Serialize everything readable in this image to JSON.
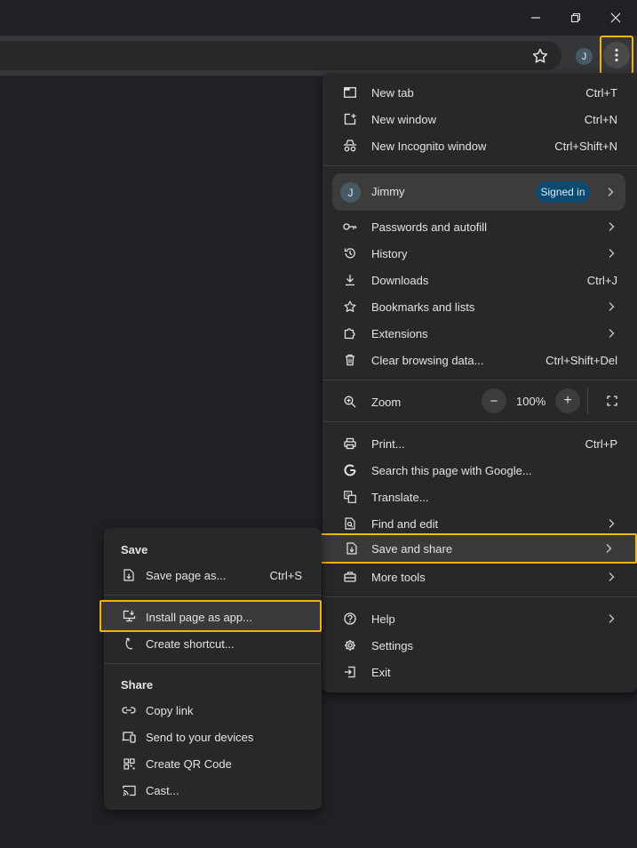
{
  "window": {
    "controls": [
      "minimize",
      "restore",
      "close"
    ]
  },
  "toolbar": {
    "avatar_initial": "J"
  },
  "menu": {
    "section1": [
      {
        "label": "New tab",
        "shortcut": "Ctrl+T",
        "icon": "new-tab-icon"
      },
      {
        "label": "New window",
        "shortcut": "Ctrl+N",
        "icon": "new-window-icon"
      },
      {
        "label": "New Incognito window",
        "shortcut": "Ctrl+Shift+N",
        "icon": "incognito-icon"
      }
    ],
    "profile": {
      "initial": "J",
      "name": "Jimmy",
      "badge": "Signed in"
    },
    "section2": [
      {
        "label": "Passwords and autofill",
        "icon": "key-icon"
      },
      {
        "label": "History",
        "icon": "history-icon"
      },
      {
        "label": "Downloads",
        "shortcut": "Ctrl+J",
        "icon": "download-icon"
      },
      {
        "label": "Bookmarks and lists",
        "icon": "star-icon"
      },
      {
        "label": "Extensions",
        "icon": "puzzle-icon"
      },
      {
        "label": "Clear browsing data...",
        "shortcut": "Ctrl+Shift+Del",
        "icon": "trash-icon"
      }
    ],
    "zoom": {
      "label": "Zoom",
      "value": "100%",
      "minus": "−",
      "plus": "+"
    },
    "section3": [
      {
        "label": "Print...",
        "shortcut": "Ctrl+P",
        "icon": "print-icon"
      },
      {
        "label": "Search this page with Google...",
        "icon": "google-icon"
      },
      {
        "label": "Translate...",
        "icon": "translate-icon"
      },
      {
        "label": "Find and edit",
        "icon": "find-icon"
      },
      {
        "label": "Save and share",
        "icon": "save-share-icon"
      },
      {
        "label": "More tools",
        "icon": "toolbox-icon"
      }
    ],
    "section4": [
      {
        "label": "Help",
        "icon": "help-icon"
      },
      {
        "label": "Settings",
        "icon": "gear-icon"
      },
      {
        "label": "Exit",
        "icon": "exit-icon"
      }
    ]
  },
  "submenu": {
    "save_heading": "Save",
    "save_items": [
      {
        "label": "Save page as...",
        "shortcut": "Ctrl+S",
        "icon": "save-page-icon"
      }
    ],
    "app_items": [
      {
        "label": "Install page as app...",
        "icon": "install-app-icon"
      },
      {
        "label": "Create shortcut...",
        "icon": "shortcut-icon"
      }
    ],
    "share_heading": "Share",
    "share_items": [
      {
        "label": "Copy link",
        "icon": "link-icon"
      },
      {
        "label": "Send to your devices",
        "icon": "devices-icon"
      },
      {
        "label": "Create QR Code",
        "icon": "qr-code-icon"
      },
      {
        "label": "Cast...",
        "icon": "cast-icon"
      }
    ]
  },
  "colors": {
    "highlight": "#f5b400",
    "menu_bg": "#282828",
    "text": "#e3e3e3",
    "badge_bg": "#0c4a72"
  }
}
